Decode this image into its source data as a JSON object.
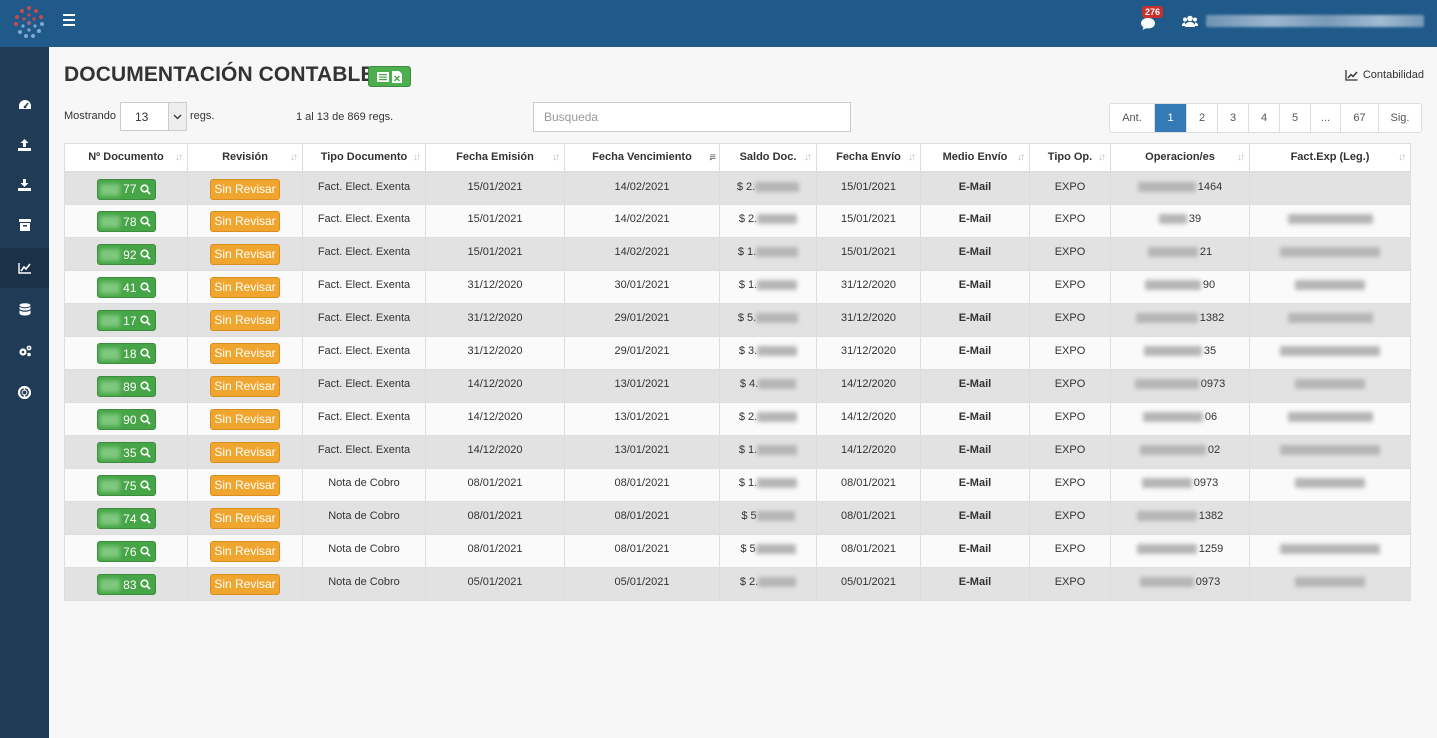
{
  "header": {
    "notif_count": "276",
    "colors": {
      "topbar": "#1f5a8a",
      "sidebar": "#1f3b55",
      "accent": "#337ab7",
      "doc_green": "#46a546",
      "revision_orange": "#f0a52f"
    }
  },
  "sidebar": {
    "items": [
      {
        "icon": "dashboard-icon"
      },
      {
        "icon": "upload-icon"
      },
      {
        "icon": "download-icon"
      },
      {
        "icon": "archive-icon"
      },
      {
        "icon": "chart-icon",
        "active": true
      },
      {
        "icon": "database-icon"
      },
      {
        "icon": "gears-icon"
      },
      {
        "icon": "lifebuoy-icon"
      }
    ]
  },
  "page": {
    "title": "DOCUMENTACIÓN CONTABLE",
    "contabilidad_link": "Contabilidad",
    "mostrando_label": "Mostrando",
    "regs_value": "13",
    "regs_label": "regs.",
    "info_range": "1 al 13 de 869 regs.",
    "search_placeholder": "Busqueda"
  },
  "pagination": {
    "prev": "Ant.",
    "pages": [
      "1",
      "2",
      "3",
      "4",
      "5",
      "...",
      "67"
    ],
    "next": "Sig.",
    "active": "1"
  },
  "table": {
    "columns": [
      "Nº Documento",
      "Revisión",
      "Tipo Documento",
      "Fecha Emisión",
      "Fecha Vencimiento",
      "Saldo Doc.",
      "Fecha Envío",
      "Medio Envío",
      "Tipo Op.",
      "Operacion/es",
      "Fact.Exp (Leg.)"
    ],
    "rows": [
      {
        "doc": "77",
        "revision": "Sin Revisar",
        "tipo": "Fact. Elect. Exenta",
        "emision": "15/01/2021",
        "vencimiento": "14/02/2021",
        "saldo": "$ 2.",
        "envio": "15/01/2021",
        "medio": "E-Mail",
        "tipo_op": "EXPO",
        "operacion": "1464"
      },
      {
        "doc": "78",
        "revision": "Sin Revisar",
        "tipo": "Fact. Elect. Exenta",
        "emision": "15/01/2021",
        "vencimiento": "14/02/2021",
        "saldo": "$ 2.",
        "envio": "15/01/2021",
        "medio": "E-Mail",
        "tipo_op": "EXPO",
        "operacion": "39"
      },
      {
        "doc": "92",
        "revision": "Sin Revisar",
        "tipo": "Fact. Elect. Exenta",
        "emision": "15/01/2021",
        "vencimiento": "14/02/2021",
        "saldo": "$ 1.",
        "envio": "15/01/2021",
        "medio": "E-Mail",
        "tipo_op": "EXPO",
        "operacion": "21"
      },
      {
        "doc": "41",
        "revision": "Sin Revisar",
        "tipo": "Fact. Elect. Exenta",
        "emision": "31/12/2020",
        "vencimiento": "30/01/2021",
        "saldo": "$ 1.",
        "envio": "31/12/2020",
        "medio": "E-Mail",
        "tipo_op": "EXPO",
        "operacion": "90"
      },
      {
        "doc": "17",
        "revision": "Sin Revisar",
        "tipo": "Fact. Elect. Exenta",
        "emision": "31/12/2020",
        "vencimiento": "29/01/2021",
        "saldo": "$ 5.",
        "envio": "31/12/2020",
        "medio": "E-Mail",
        "tipo_op": "EXPO",
        "operacion": "1382"
      },
      {
        "doc": "18",
        "revision": "Sin Revisar",
        "tipo": "Fact. Elect. Exenta",
        "emision": "31/12/2020",
        "vencimiento": "29/01/2021",
        "saldo": "$ 3.",
        "envio": "31/12/2020",
        "medio": "E-Mail",
        "tipo_op": "EXPO",
        "operacion": "35"
      },
      {
        "doc": "89",
        "revision": "Sin Revisar",
        "tipo": "Fact. Elect. Exenta",
        "emision": "14/12/2020",
        "vencimiento": "13/01/2021",
        "saldo": "$ 4.",
        "envio": "14/12/2020",
        "medio": "E-Mail",
        "tipo_op": "EXPO",
        "operacion": "0973"
      },
      {
        "doc": "90",
        "revision": "Sin Revisar",
        "tipo": "Fact. Elect. Exenta",
        "emision": "14/12/2020",
        "vencimiento": "13/01/2021",
        "saldo": "$ 2.",
        "envio": "14/12/2020",
        "medio": "E-Mail",
        "tipo_op": "EXPO",
        "operacion": "06"
      },
      {
        "doc": "35",
        "revision": "Sin Revisar",
        "tipo": "Fact. Elect. Exenta",
        "emision": "14/12/2020",
        "vencimiento": "13/01/2021",
        "saldo": "$ 1.",
        "envio": "14/12/2020",
        "medio": "E-Mail",
        "tipo_op": "EXPO",
        "operacion": "02"
      },
      {
        "doc": "75",
        "revision": "Sin Revisar",
        "tipo": "Nota de Cobro",
        "emision": "08/01/2021",
        "vencimiento": "08/01/2021",
        "saldo": "$ 1.",
        "envio": "08/01/2021",
        "medio": "E-Mail",
        "tipo_op": "EXPO",
        "operacion": "0973"
      },
      {
        "doc": "74",
        "revision": "Sin Revisar",
        "tipo": "Nota de Cobro",
        "emision": "08/01/2021",
        "vencimiento": "08/01/2021",
        "saldo": "$ 5",
        "envio": "08/01/2021",
        "medio": "E-Mail",
        "tipo_op": "EXPO",
        "operacion": "1382"
      },
      {
        "doc": "76",
        "revision": "Sin Revisar",
        "tipo": "Nota de Cobro",
        "emision": "08/01/2021",
        "vencimiento": "08/01/2021",
        "saldo": "$ 5",
        "envio": "08/01/2021",
        "medio": "E-Mail",
        "tipo_op": "EXPO",
        "operacion": "1259"
      },
      {
        "doc": "83",
        "revision": "Sin Revisar",
        "tipo": "Nota de Cobro",
        "emision": "05/01/2021",
        "vencimiento": "05/01/2021",
        "saldo": "$ 2.",
        "envio": "05/01/2021",
        "medio": "E-Mail",
        "tipo_op": "EXPO",
        "operacion": "0973"
      }
    ]
  }
}
